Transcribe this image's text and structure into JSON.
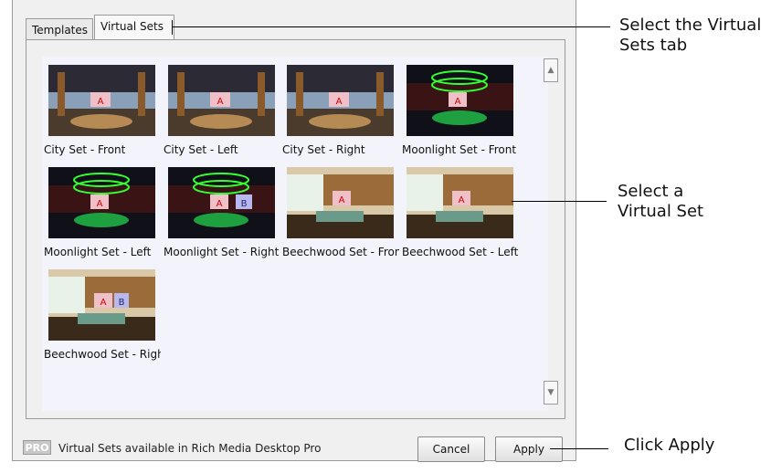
{
  "tabs": [
    {
      "label": "Templates"
    },
    {
      "label": "Virtual Sets"
    }
  ],
  "sets": [
    {
      "label": "City Set - Front",
      "scene": "city"
    },
    {
      "label": "City Set - Left",
      "scene": "city"
    },
    {
      "label": "City Set - Right",
      "scene": "city"
    },
    {
      "label": "Moonlight Set - Front",
      "scene": "moonlight"
    },
    {
      "label": "Moonlight Set - Left",
      "scene": "moonlight"
    },
    {
      "label": "Moonlight Set - Right",
      "scene": "moonlight"
    },
    {
      "label": "Beechwood Set - Front",
      "scene": "beechwood"
    },
    {
      "label": "Beechwood Set - Left",
      "scene": "beechwood"
    },
    {
      "label": "Beechwood Set - Right",
      "scene": "beechwood"
    }
  ],
  "scene_glyphs": {
    "a": "A",
    "b": "B"
  },
  "footer": {
    "pro_badge": "PRO",
    "pro_text": "Virtual Sets available in Rich Media Desktop Pro",
    "cancel": "Cancel",
    "apply": "Apply"
  },
  "callouts": {
    "tab_line1": "Select the Virtual",
    "tab_line2": "Sets tab",
    "set_line1": "Select a",
    "set_line2": "Virtual Set",
    "apply": "Click Apply"
  },
  "scrollbar": {
    "up_glyph": "▲",
    "down_glyph": "▼"
  }
}
